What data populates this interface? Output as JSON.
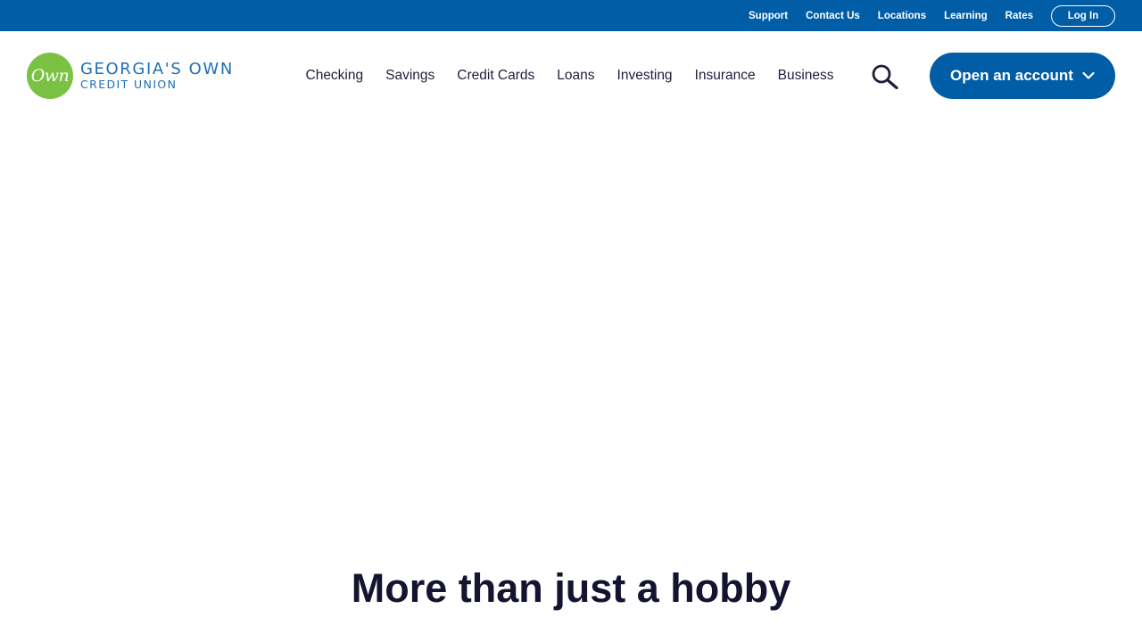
{
  "utility_nav": {
    "links": [
      "Support",
      "Contact Us",
      "Locations",
      "Learning",
      "Rates"
    ],
    "login_label": "Log In"
  },
  "logo": {
    "mark_text": "Own",
    "line1": "GEORGIA'S OWN",
    "line2": "CREDIT UNION"
  },
  "primary_nav": {
    "items": [
      "Checking",
      "Savings",
      "Credit Cards",
      "Loans",
      "Investing",
      "Insurance",
      "Business"
    ]
  },
  "search": {
    "icon": "search-icon"
  },
  "cta": {
    "open_account_label": "Open an account",
    "icon": "chevron-down-icon"
  },
  "main": {
    "section_title": "More than just a hobby"
  },
  "colors": {
    "brand_blue": "#005da6",
    "logo_green": "#7bc143",
    "logo_text_blue": "#1f6fb6",
    "nav_text": "#1e1e3c",
    "heading_text": "#141430"
  }
}
